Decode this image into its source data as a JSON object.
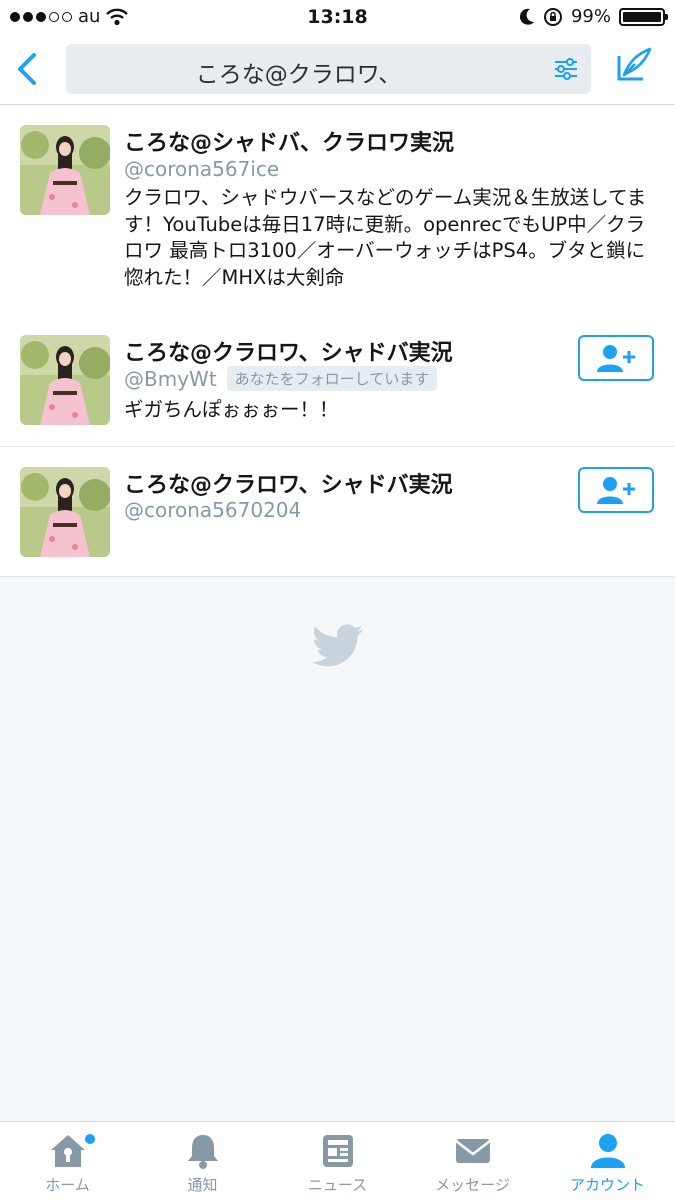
{
  "status_bar": {
    "carrier": "au",
    "time": "13:18",
    "battery_percent": "99%",
    "battery_level": 0.99,
    "signal_bars_filled": 3,
    "signal_bars_total": 5
  },
  "nav": {
    "search_query": "ころな@クラロワ、",
    "back_icon": "chevron-left-icon",
    "filter_icon": "sliders-icon",
    "compose_icon": "compose-icon"
  },
  "results": [
    {
      "name": "ころな@シャドバ、クラロワ実況",
      "handle": "@corona567ice",
      "follows_you": "",
      "bio": "クラロワ、シャドウバースなどのゲーム実況＆生放送してます！YouTubeは毎日17時に更新。openrecでもUP中／クラロワ 最高トロ3100／オーバーウォッチはPS4。ブタと鎖に惚れた！／MHXは大剣命",
      "show_follow_button": false
    },
    {
      "name": "ころな@クラロワ、シャドバ実況",
      "handle": "@BmyWt",
      "follows_you": "あなたをフォローしています",
      "bio": "ギガちんぽぉぉぉー！！",
      "show_follow_button": true
    },
    {
      "name": "ころな@クラロワ、シャドバ実況",
      "handle": "@corona5670204",
      "follows_you": "",
      "bio": "",
      "show_follow_button": true
    }
  ],
  "tabbar": {
    "tabs": [
      {
        "label": "ホーム",
        "icon": "home-icon",
        "active": false,
        "has_badge": true
      },
      {
        "label": "通知",
        "icon": "bell-icon",
        "active": false,
        "has_badge": false
      },
      {
        "label": "ニュース",
        "icon": "news-icon",
        "active": false,
        "has_badge": false
      },
      {
        "label": "メッセージ",
        "icon": "envelope-icon",
        "active": false,
        "has_badge": false
      },
      {
        "label": "アカウント",
        "icon": "person-icon",
        "active": true,
        "has_badge": false
      }
    ]
  },
  "colors": {
    "accent": "#1da1f2",
    "background": "#f5f8fa",
    "secondary_text": "#8899a6"
  }
}
